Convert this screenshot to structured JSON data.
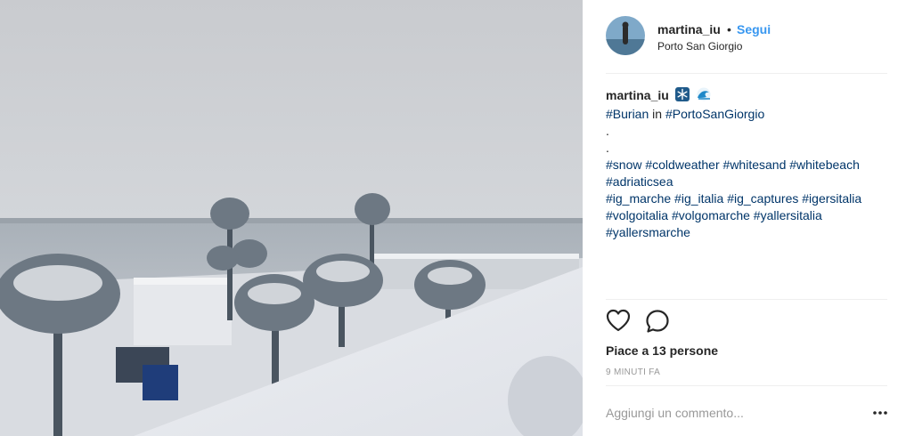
{
  "post": {
    "username": "martina_iu",
    "separator": "•",
    "follow_label": "Segui",
    "location": "Porto San Giorgio",
    "photo_description_icon": "snowy-seaside-photo"
  },
  "caption": {
    "username": "martina_iu",
    "emojis": [
      "snowflake-emoji",
      "wave-emoji"
    ],
    "line1_tag1": "#Burian",
    "line1_word": " in ",
    "line1_tag2": "#PortoSanGiorgio",
    "dot1": ".",
    "dot2": ".",
    "tags_line3": [
      "#snow",
      "#coldweather",
      "#whitesand",
      "#whitebeach"
    ],
    "tags_line4": [
      "#adriaticsea"
    ],
    "tags_line5": [
      "#ig_marche",
      "#ig_italia",
      "#ig_captures",
      "#igersitalia"
    ],
    "tags_line6": [
      "#volgoitalia",
      "#volgomarche",
      "#yallersitalia"
    ],
    "tags_line7": [
      "#yallersmarche"
    ]
  },
  "actions": {
    "like_icon": "heart-icon",
    "comment_icon": "comment-icon",
    "likes_text": "Piace a 13 persone",
    "time_text": "9 MINUTI FA"
  },
  "comment_box": {
    "placeholder": "Aggiungi un commento...",
    "more_icon": "more-options-icon"
  },
  "colors": {
    "link": "#003569",
    "follow": "#3897f0",
    "muted": "#999999"
  }
}
